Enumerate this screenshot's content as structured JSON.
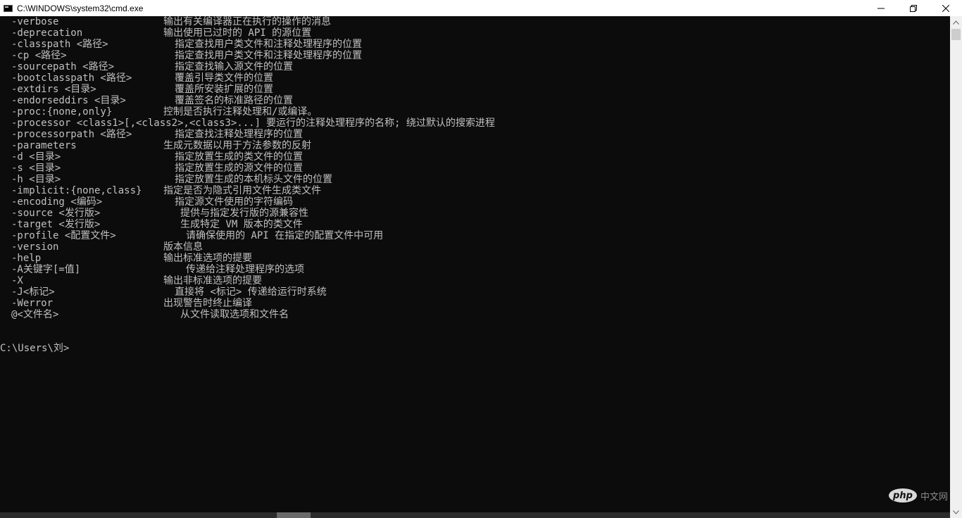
{
  "window": {
    "title": "C:\\WINDOWS\\system32\\cmd.exe"
  },
  "options": [
    {
      "name": "-verbose",
      "desc": "输出有关编译器正在执行的操作的消息",
      "indent": 0
    },
    {
      "name": "-deprecation",
      "desc": "输出使用已过时的 API 的源位置",
      "indent": 0
    },
    {
      "name": "-classpath <路径>",
      "desc": "指定查找用户类文件和注释处理程序的位置",
      "indent": 2
    },
    {
      "name": "-cp <路径>",
      "desc": "指定查找用户类文件和注释处理程序的位置",
      "indent": 2
    },
    {
      "name": "-sourcepath <路径>",
      "desc": "指定查找输入源文件的位置",
      "indent": 2
    },
    {
      "name": "-bootclasspath <路径>",
      "desc": "覆盖引导类文件的位置",
      "indent": 2
    },
    {
      "name": "-extdirs <目录>",
      "desc": "覆盖所安装扩展的位置",
      "indent": 2
    },
    {
      "name": "-endorseddirs <目录>",
      "desc": "覆盖签名的标准路径的位置",
      "indent": 2
    },
    {
      "name": "-proc:{none,only}",
      "desc": "控制是否执行注释处理和/或编译。",
      "indent": 0
    },
    {
      "name": "-processor <class1>[,<class2>,<class3>...]",
      "desc": "要运行的注释处理程序的名称; 绕过默认的搜索进程",
      "indent": -1
    },
    {
      "name": "-processorpath <路径>",
      "desc": "指定查找注释处理程序的位置",
      "indent": 2
    },
    {
      "name": "-parameters",
      "desc": "生成元数据以用于方法参数的反射",
      "indent": 0
    },
    {
      "name": "-d <目录>",
      "desc": "指定放置生成的类文件的位置",
      "indent": 2
    },
    {
      "name": "-s <目录>",
      "desc": "指定放置生成的源文件的位置",
      "indent": 2
    },
    {
      "name": "-h <目录>",
      "desc": "指定放置生成的本机标头文件的位置",
      "indent": 2
    },
    {
      "name": "-implicit:{none,class}",
      "desc": "指定是否为隐式引用文件生成类文件",
      "indent": 0
    },
    {
      "name": "-encoding <编码>",
      "desc": "指定源文件使用的字符编码",
      "indent": 2
    },
    {
      "name": "-source <发行版>",
      "desc": "提供与指定发行版的源兼容性",
      "indent": 3
    },
    {
      "name": "-target <发行版>",
      "desc": "生成特定 VM 版本的类文件",
      "indent": 3
    },
    {
      "name": "-profile <配置文件>",
      "desc": "请确保使用的 API 在指定的配置文件中可用",
      "indent": 4
    },
    {
      "name": "-version",
      "desc": "版本信息",
      "indent": 0
    },
    {
      "name": "-help",
      "desc": "输出标准选项的提要",
      "indent": 0
    },
    {
      "name": "-A关键字[=值]",
      "desc": "传递给注释处理程序的选项",
      "indent": 4
    },
    {
      "name": "-X",
      "desc": "输出非标准选项的提要",
      "indent": 0
    },
    {
      "name": "-J<标记>",
      "desc": "直接将 <标记> 传递给运行时系统",
      "indent": 2
    },
    {
      "name": "-Werror",
      "desc": "出现警告时终止编译",
      "indent": 0
    },
    {
      "name": "@<文件名>",
      "desc": "从文件读取选项和文件名",
      "indent": 3
    }
  ],
  "prompt": "C:\\Users\\刘>",
  "watermark": {
    "logo": "php",
    "text": "中文网"
  },
  "colors": {
    "console_bg": "#0c0c0c",
    "console_fg": "#c0c0c0",
    "titlebar_bg": "#ffffff"
  }
}
